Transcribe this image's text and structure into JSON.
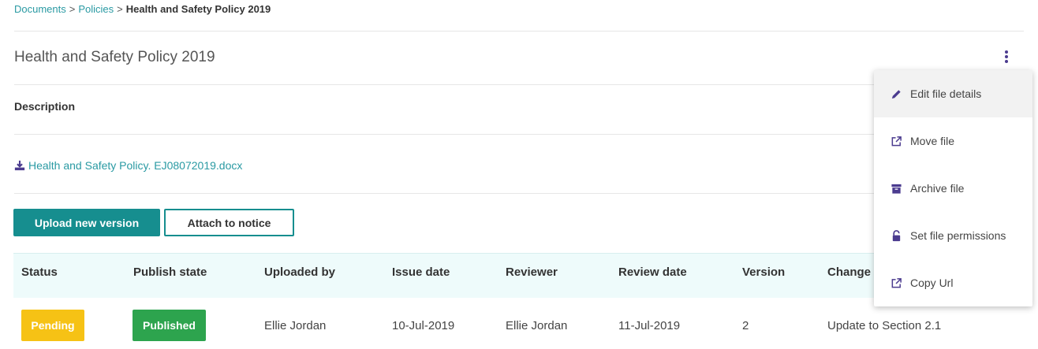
{
  "breadcrumb": {
    "items": [
      "Documents",
      "Policies"
    ],
    "separator": ">",
    "current": "Health and Safety Policy 2019"
  },
  "page": {
    "title": "Health and Safety Policy 2019",
    "description_label": "Description",
    "file_name": "Health and Safety Policy. EJ08072019.docx"
  },
  "actions": {
    "upload_label": "Upload new version",
    "attach_label": "Attach to notice"
  },
  "table": {
    "headers": [
      "Status",
      "Publish state",
      "Uploaded by",
      "Issue date",
      "Reviewer",
      "Review date",
      "Version",
      "Change"
    ],
    "row": {
      "status": "Pending",
      "publish_state": "Published",
      "uploaded_by": "Ellie Jordan",
      "issue_date": "10-Jul-2019",
      "reviewer": "Ellie Jordan",
      "review_date": "11-Jul-2019",
      "version": "2",
      "change": "Update to Section 2.1"
    }
  },
  "menu": {
    "items": [
      {
        "label": "Edit file details",
        "icon": "pencil-icon"
      },
      {
        "label": "Move file",
        "icon": "external-link-icon"
      },
      {
        "label": "Archive file",
        "icon": "archive-icon"
      },
      {
        "label": "Set file permissions",
        "icon": "lock-icon"
      },
      {
        "label": "Copy Url",
        "icon": "external-link-icon"
      }
    ]
  },
  "colors": {
    "accent": "#168e8f",
    "link": "#2a9aa3",
    "icon": "#4b3b8f",
    "pending": "#f6c215",
    "published": "#2da44e"
  }
}
